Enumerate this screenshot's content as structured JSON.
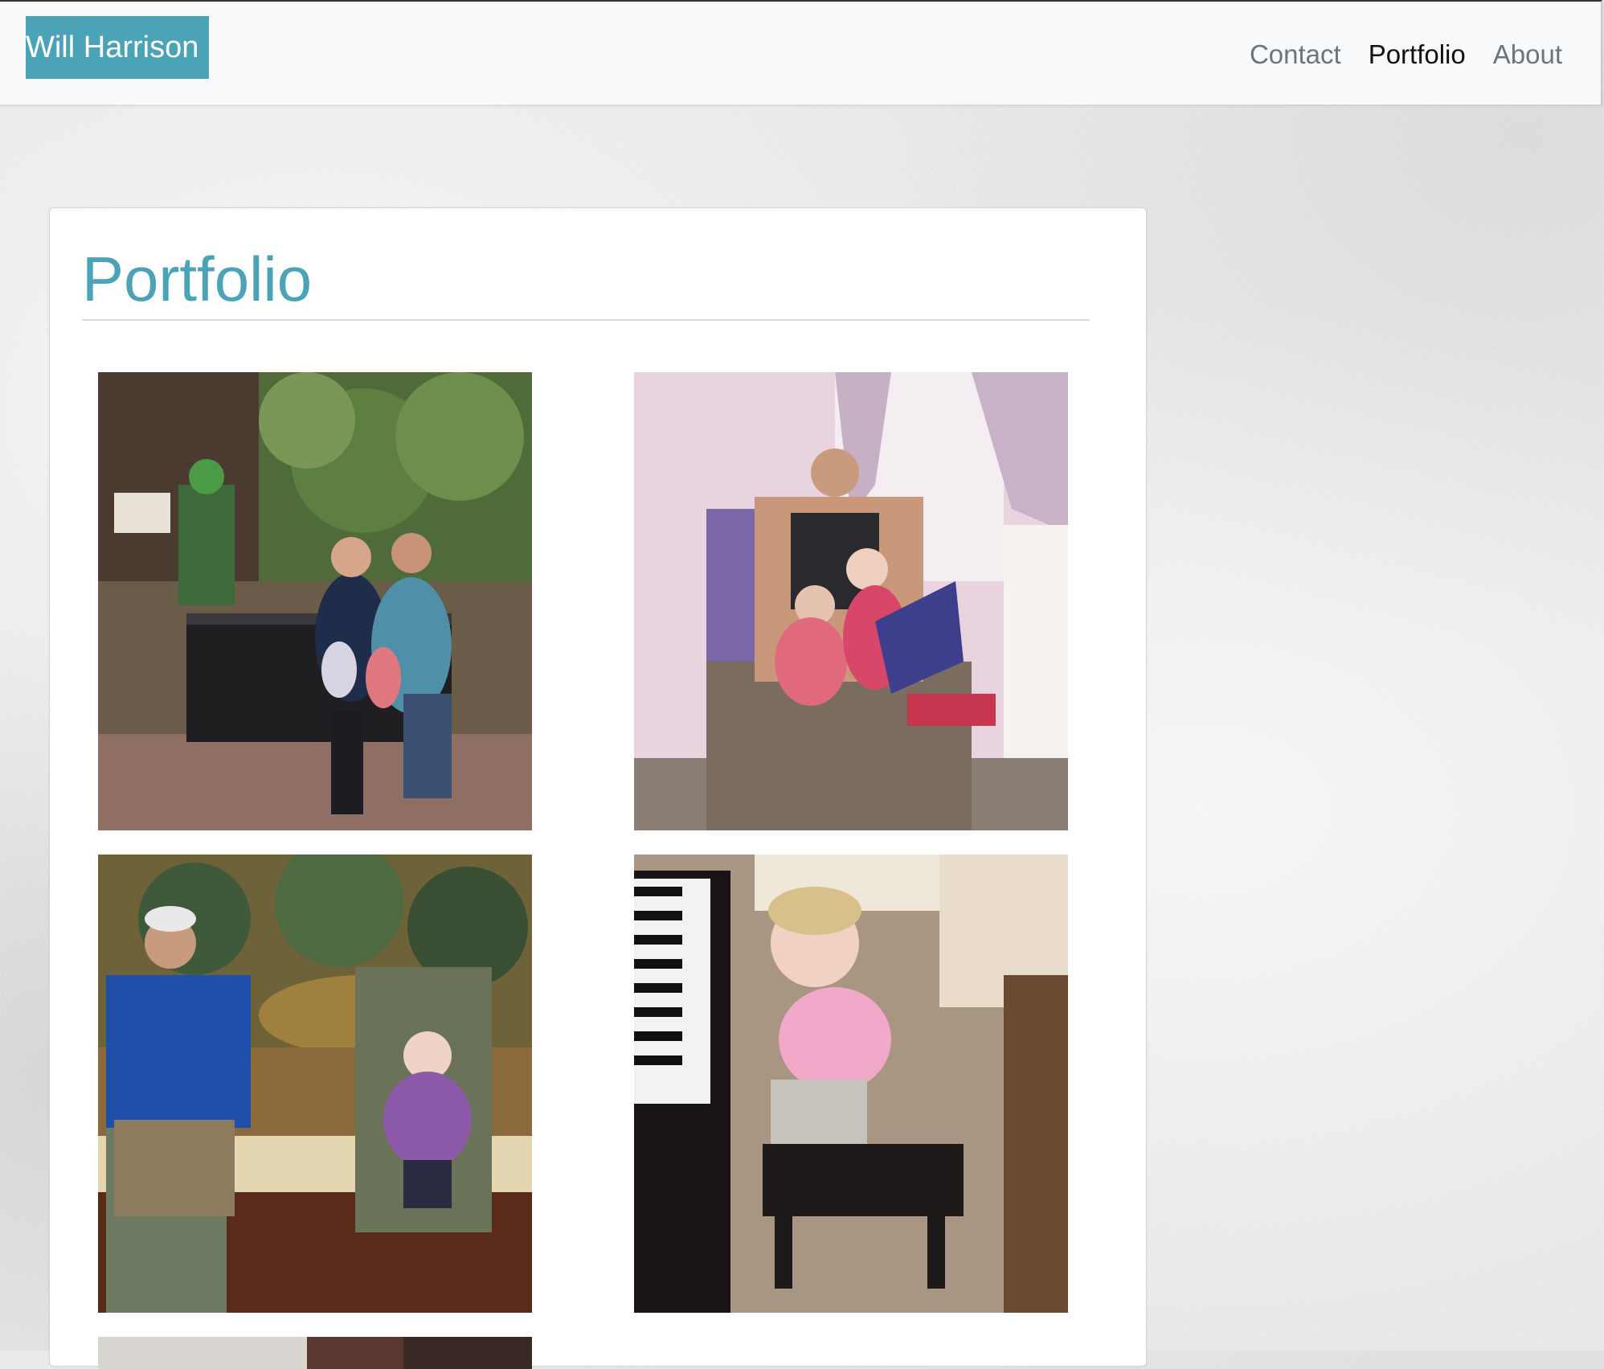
{
  "navbar": {
    "brand": "Will Harrison",
    "links": [
      {
        "label": "Contact",
        "active": false
      },
      {
        "label": "Portfolio",
        "active": true
      },
      {
        "label": "About",
        "active": false
      }
    ]
  },
  "main": {
    "title": "Portfolio"
  },
  "colors": {
    "accent": "#4aa3b6",
    "nav_bg": "#f8f9fa",
    "nav_link": "#6c757d",
    "nav_link_active": "#111111",
    "page_bg": "#eaeaea"
  }
}
